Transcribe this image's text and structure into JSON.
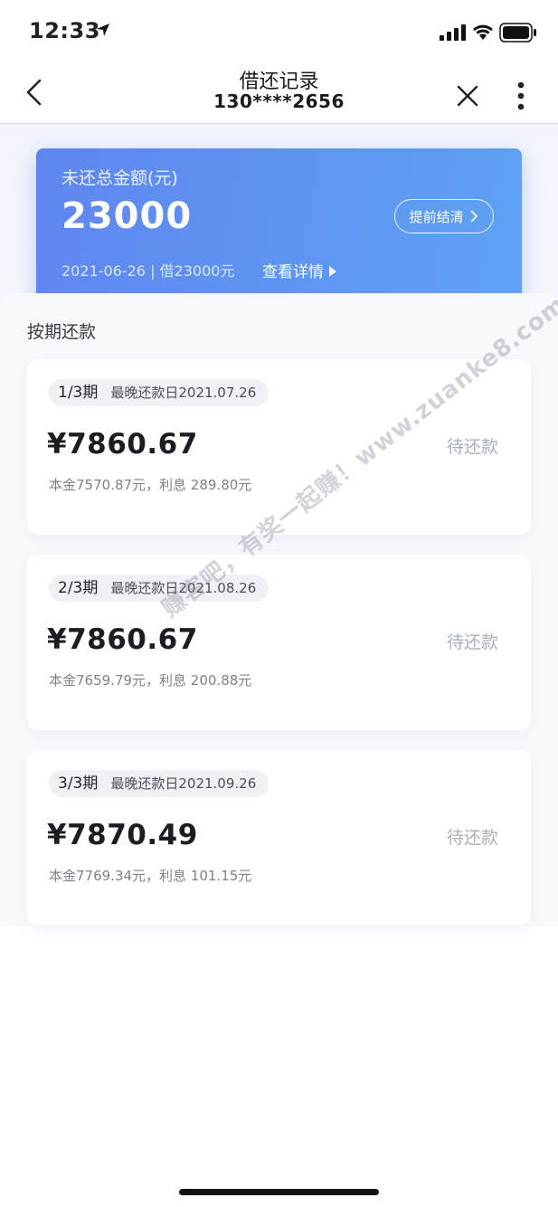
{
  "status_bar": {
    "time": "12:33"
  },
  "nav": {
    "title": "借还记录",
    "subtitle": "130****2656"
  },
  "summary": {
    "label": "未还总金额(元)",
    "amount": "23000",
    "prepay_button": "提前结清",
    "meta": "2021-06-26 | 借23000元",
    "detail_link": "查看详情"
  },
  "section_title": "按期还款",
  "installments": [
    {
      "period": "1/3期",
      "due": "最晚还款日2021.07.26",
      "amount": "¥7860.67",
      "status": "待还款",
      "breakdown": "本金7570.87元，利息 289.80元"
    },
    {
      "period": "2/3期",
      "due": "最晚还款日2021.08.26",
      "amount": "¥7860.67",
      "status": "待还款",
      "breakdown": "本金7659.79元，利息 200.88元"
    },
    {
      "period": "3/3期",
      "due": "最晚还款日2021.09.26",
      "amount": "¥7870.49",
      "status": "待还款",
      "breakdown": "本金7769.34元，利息 101.15元"
    }
  ],
  "watermark": "赚客吧，有奖一起赚！www.zuanke8.com",
  "colors": {
    "card_gradient_start": "#5f86ef",
    "card_gradient_end": "#5ea2f4",
    "status_pending": "#a7b0bd"
  }
}
